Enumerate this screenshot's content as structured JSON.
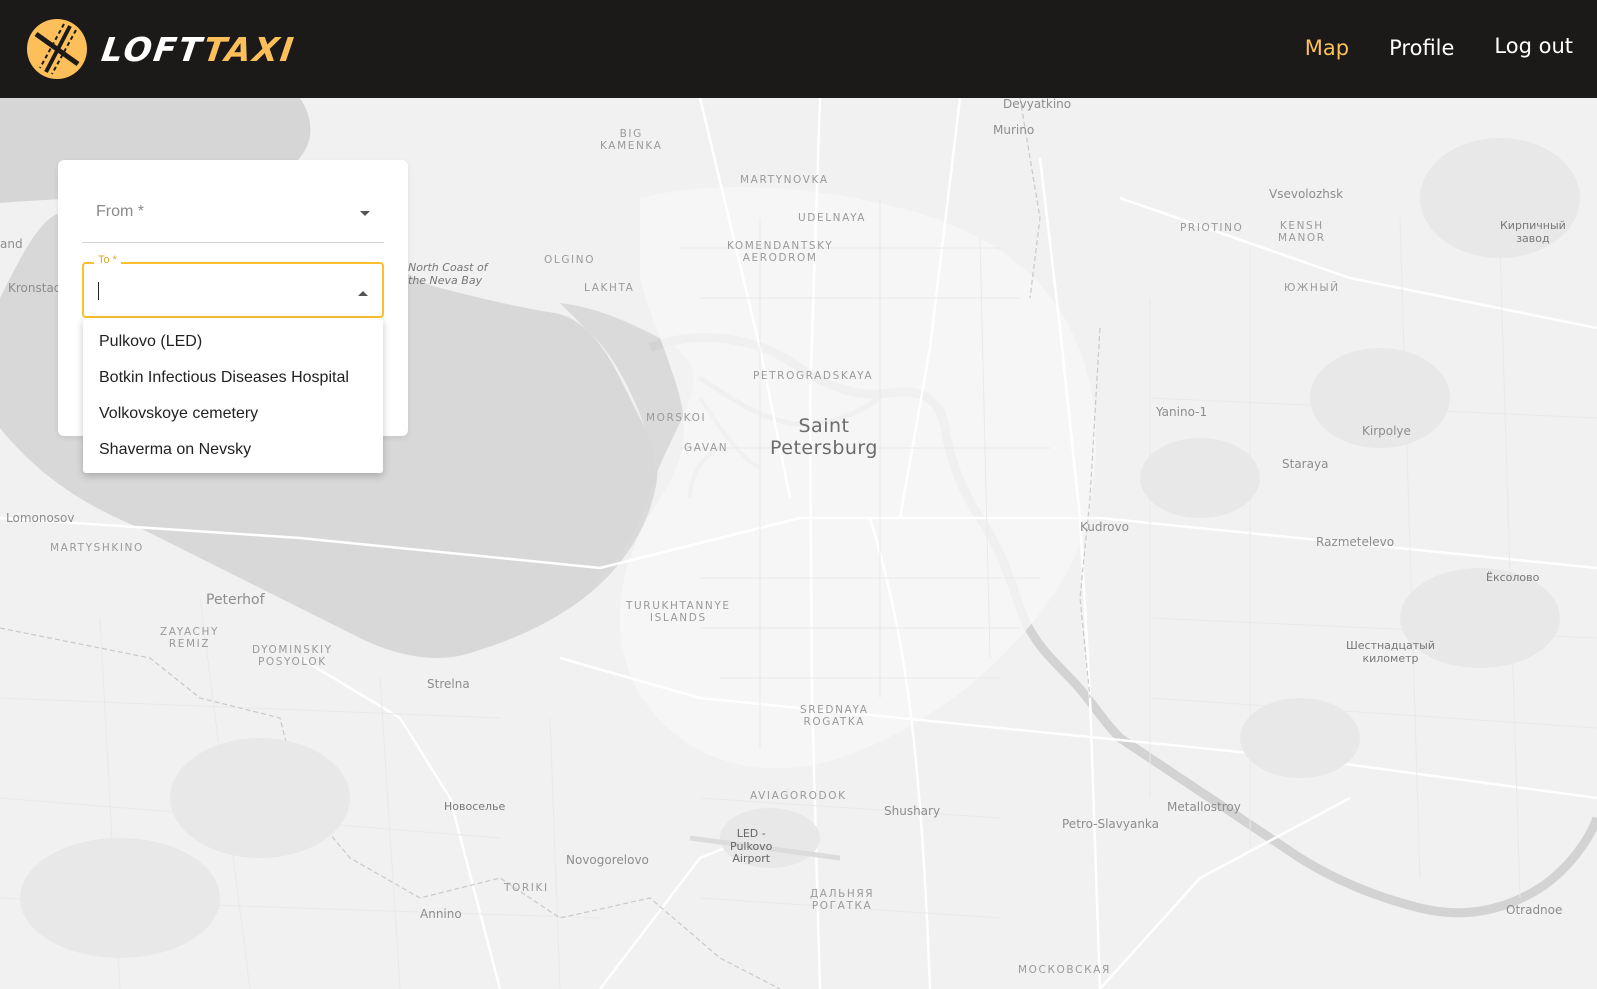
{
  "header": {
    "logo_part1": "LOFT",
    "logo_part2": "TAXI",
    "brand_color": "#fdbf5a",
    "nav": {
      "map": "Map",
      "profile": "Profile",
      "logout": "Log out"
    },
    "active_nav": "map"
  },
  "form": {
    "from_label": "From *",
    "to_label": "To *",
    "to_value": "",
    "options": [
      "Pulkovo (LED)",
      "Botkin Infectious Diseases Hospital",
      "Volkovskoye cemetery",
      "Shaverma on Nevsky"
    ]
  },
  "map": {
    "labels": {
      "devyatkino": "Devyatkino",
      "murino": "Murino",
      "big_kamenka": "BIG\nKAMENKA",
      "martynovka": "MARTYNOVKA",
      "udelnaya": "UDELNAYA",
      "vsevolozhsk": "Vsevolozhsk",
      "priotino": "PRIOTINO",
      "kensh_manor": "KENSH\nMANOR",
      "kirpichny": "Кирпичный\nзавод",
      "komendantsky": "KOMENDANTSKY\nAERODROM",
      "olgino": "OLGINO",
      "north_coast": "North Coast of\nthe Neva Bay",
      "lakhta": "LAKHTA",
      "yuzhny": "ЮЖНЫЙ",
      "kronstadt": "Kronstad",
      "and": "and",
      "petrogradskaya": "PETROGRADSKAYA",
      "saint_petersburg": "Saint\nPetersburg",
      "morskoi": "MORSKOI",
      "gavan": "GAVAN",
      "yanino": "Yanino-1",
      "kirpolye": "Kirpolye",
      "staraya": "Staraya",
      "lomonosov": "Lomonosov",
      "martyshkino": "MARTYSHKINO",
      "kudrovo": "Kudrovo",
      "razmetelevo": "Razmetelevo",
      "eskolovo": "Ёксолово",
      "peterhof": "Peterhof",
      "turukhtannye": "TURUKHTANNYE\nISLANDS",
      "zayachy": "ZAYACHY\nREMIZ",
      "dyominskiy": "DYOMINSKIY\nPOSYOLOK",
      "shestnadtsaty": "Шестнадцатый\nкилометр",
      "strelna": "Strelna",
      "srednaya": "SREDNAYA\nROGATKA",
      "aviagorodok": "AVIAGORODOK",
      "shushary": "Shushary",
      "metallostroy": "Metallostroy",
      "novoselye": "Новоселье",
      "petro_slavyanka": "Petro-Slavyanka",
      "led_pulkovo": "LED -\nPulkovo\nAirport",
      "novogorelovo": "Novogorelovo",
      "toriki": "TORIKI",
      "dalnyaya": "ДАЛЬНЯЯ\nРОГАТКА",
      "otradnoe": "Otradnoe",
      "annino": "Annino",
      "moskovskaya": "МОСКОВСКАЯ"
    }
  }
}
